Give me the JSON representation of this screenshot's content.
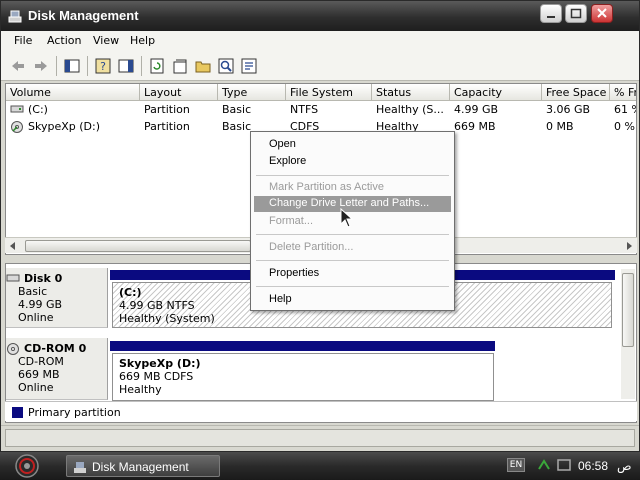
{
  "window": {
    "title": "Disk Management"
  },
  "menubar": [
    "File",
    "Action",
    "View",
    "Help"
  ],
  "toolbar": [
    "back-icon",
    "forward-icon",
    "up-icon",
    "help-icon",
    "view-icon",
    "refresh-icon",
    "properties-icon",
    "open-icon",
    "search-icon",
    "export-icon"
  ],
  "volume_list": {
    "columns": [
      "Volume",
      "Layout",
      "Type",
      "File System",
      "Status",
      "Capacity",
      "Free Space",
      "% Fr"
    ],
    "rows": [
      [
        "(C:)",
        "Partition",
        "Basic",
        "NTFS",
        "Healthy (S...",
        "4.99 GB",
        "3.06 GB",
        "61 %"
      ],
      [
        "SkypeXp (D:)",
        "Partition",
        "Basic",
        "CDFS",
        "Healthy",
        "669 MB",
        "0 MB",
        "0 %"
      ]
    ]
  },
  "context_menu": {
    "items": [
      {
        "label": "Open",
        "disabled": false,
        "highlighted": false
      },
      {
        "label": "Explore",
        "disabled": false,
        "highlighted": false
      },
      {
        "label": "Mark Partition as Active",
        "disabled": true,
        "highlighted": false
      },
      {
        "label": "Change Drive Letter and Paths...",
        "disabled": false,
        "highlighted": true
      },
      {
        "label": "Format...",
        "disabled": true,
        "highlighted": false
      },
      {
        "label": "Delete Partition...",
        "disabled": true,
        "highlighted": false
      },
      {
        "label": "Properties",
        "disabled": false,
        "highlighted": false
      },
      {
        "label": "Help",
        "disabled": false,
        "highlighted": false
      }
    ]
  },
  "disks": [
    {
      "name": "Disk 0",
      "kind": "Basic",
      "size": "4.99 GB",
      "state": "Online",
      "partition": {
        "name": "(C:)",
        "detail": "4.99 GB NTFS",
        "status": "Healthy (System)"
      }
    },
    {
      "name": "CD-ROM 0",
      "kind": "CD-ROM",
      "size": "669 MB",
      "state": "Online",
      "partition": {
        "name": "SkypeXp  (D:)",
        "detail": "669 MB CDFS",
        "status": "Healthy"
      }
    }
  ],
  "legend": {
    "label": "Primary partition",
    "color": "#0a0a80"
  },
  "taskbar": {
    "task_label": "Disk Management",
    "lang": "EN",
    "clock": "06:58",
    "ampm": "ص"
  }
}
